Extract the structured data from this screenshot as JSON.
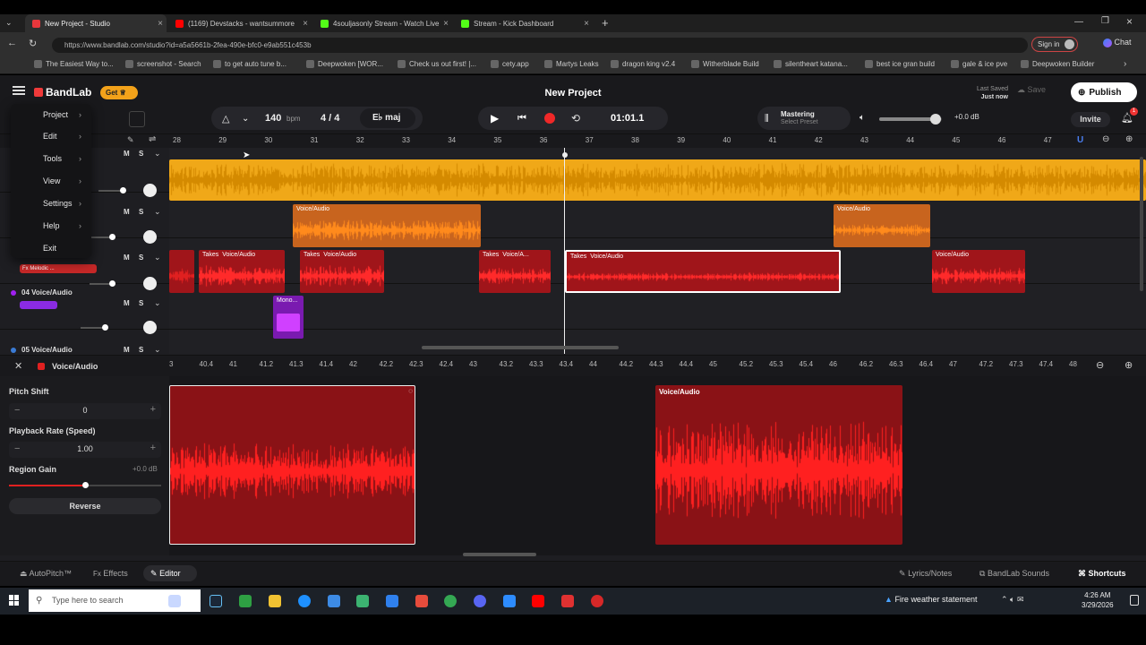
{
  "browser": {
    "tabs": [
      {
        "label": "New Project - Studio",
        "active": true,
        "color": "#e8373c"
      },
      {
        "label": "(1169) Devstacks - wantsummore",
        "active": false,
        "color": "#ff0000"
      },
      {
        "label": "4souljasonly Stream - Watch Live",
        "active": false,
        "color": "#53fc18"
      },
      {
        "label": "Stream - Kick Dashboard",
        "active": false,
        "color": "#53fc18"
      }
    ],
    "new_tab": "+",
    "url": "https://www.bandlab.com/studio?id=a5a5661b-2fea-490e-bfc0-e9ab551c453b",
    "profile_label": "Sign in",
    "chat_label": "Chat",
    "bookmarks": [
      "The Easiest Way to...",
      "screenshot - Search",
      "to get auto tune b...",
      "Deepwoken [WOR...",
      "Check us out first! |...",
      "cety.app",
      "Martys Leaks",
      "dragon king v2.4",
      "Witherblade Build",
      "silentheart katana...",
      "best ice gran build",
      "gale & ice pve",
      "Deepwoken Builder"
    ]
  },
  "app": {
    "logo": "BandLab",
    "get_label": "Get",
    "project_title": "New Project",
    "last_saved_label": "Last Saved",
    "last_saved_value": "Just now",
    "save_label": "Save",
    "publish_label": "Publish",
    "invite_label": "Invite",
    "notification_count": "1",
    "bpm_value": "140",
    "bpm_unit": "bpm",
    "time_signature": "4 / 4",
    "key": "maj",
    "time_display": "01:01.1",
    "mastering_label": "Mastering",
    "mastering_preset": "Select Preset",
    "volume_db": "+0.0 dB",
    "volume_level": 0.9
  },
  "menu": {
    "items": [
      "Project",
      "Edit",
      "Tools",
      "View",
      "Settings",
      "Help",
      "Exit"
    ]
  },
  "ruler": {
    "ticks": [
      "28",
      "29",
      "30",
      "31",
      "32",
      "33",
      "34",
      "35",
      "36",
      "37",
      "38",
      "39",
      "40",
      "41",
      "42",
      "43",
      "44",
      "45",
      "46",
      "47"
    ]
  },
  "tracks": [
    {
      "name": "Voice/Audio",
      "mute": "M",
      "solo": "S"
    },
    {
      "name": "Voice/Audio",
      "mute": "M",
      "solo": "S"
    },
    {
      "name": "Voice/Audio",
      "mute": "M",
      "solo": "S",
      "fx": "Fx Melodic ..."
    },
    {
      "name": "04 Voice/Audio",
      "mute": "M",
      "solo": "S"
    },
    {
      "name": "05 Voice/Audio",
      "mute": "M",
      "solo": "S"
    }
  ],
  "regions": {
    "takes": "Takes",
    "voice": "Voice/Audio",
    "voice_short": "Voice/A...",
    "mono": "Mono..."
  },
  "editor": {
    "track_name": "Voice/Audio",
    "ruler_ticks": [
      "3",
      "40.4",
      "41",
      "41.2",
      "41.3",
      "41.4",
      "42",
      "42.2",
      "42.3",
      "42.4",
      "43",
      "43.2",
      "43.3",
      "43.4",
      "44",
      "44.2",
      "44.3",
      "44.4",
      "45",
      "45.2",
      "45.3",
      "45.4",
      "46",
      "46.2",
      "46.3",
      "46.4",
      "47",
      "47.2",
      "47.3",
      "47.4",
      "48"
    ],
    "pitch_shift_label": "Pitch Shift",
    "pitch_shift_value": "0",
    "playback_rate_label": "Playback Rate (Speed)",
    "playback_rate_value": "1.00",
    "region_gain_label": "Region Gain",
    "region_gain_value": "+0.0 dB",
    "reverse_label": "Reverse",
    "minus": "−",
    "plus": "+",
    "region_label": "Voice/Audio"
  },
  "bottom": {
    "autopitch": "AutoPitch™",
    "effects": "Effects",
    "editor": "Editor",
    "lyrics": "Lyrics/Notes",
    "sounds": "BandLab Sounds",
    "shortcuts": "Shortcuts"
  },
  "taskbar": {
    "search_placeholder": "Type here to search",
    "weather": "Fire weather statement",
    "time": "4:26 AM",
    "date": "3/29/2026"
  }
}
